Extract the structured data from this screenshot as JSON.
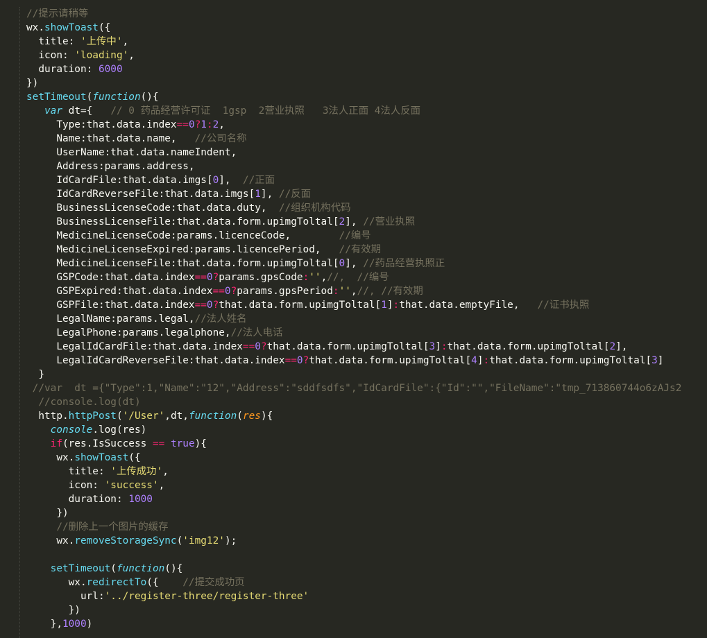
{
  "editor": {
    "theme": "Monokai",
    "colors": {
      "background": "#272822",
      "text": "#f8f8f2",
      "comment": "#75715e",
      "string": "#e6db74",
      "number": "#ae81ff",
      "function": "#66d9ef",
      "keyword": "#f92672",
      "parameter": "#fd971f"
    },
    "lines": [
      [
        [
          "c",
          "//提示请稍等"
        ]
      ],
      [
        [
          "",
          "wx."
        ],
        [
          "f",
          "showToast"
        ],
        [
          "",
          "({"
        ]
      ],
      [
        [
          "",
          "  title: "
        ],
        [
          "s",
          "'上传中'"
        ],
        [
          "",
          ","
        ]
      ],
      [
        [
          "",
          "  icon: "
        ],
        [
          "s",
          "'loading'"
        ],
        [
          "",
          ","
        ]
      ],
      [
        [
          "",
          "  duration: "
        ],
        [
          "n",
          "6000"
        ]
      ],
      [
        [
          "",
          "})"
        ]
      ],
      [
        [
          "f",
          "setTimeout"
        ],
        [
          "",
          "("
        ],
        [
          "i",
          "function"
        ],
        [
          "",
          "(){"
        ]
      ],
      [
        [
          "",
          "   "
        ],
        [
          "i",
          "var"
        ],
        [
          "",
          "",
          " dt={   "
        ],
        [
          "c",
          "// 0 药品经营许可证  1gsp  2营业执照   3法人正面 4法人反面"
        ]
      ],
      [
        [
          "",
          "     Type:that.data.index"
        ],
        [
          "k",
          "=="
        ],
        [
          "n",
          "0"
        ],
        [
          "k",
          "?"
        ],
        [
          "n",
          "1"
        ],
        [
          "k",
          ":"
        ],
        [
          "n",
          "2"
        ],
        [
          "",
          ","
        ]
      ],
      [
        [
          "",
          "     Name:that.data.name,   "
        ],
        [
          "c",
          "//公司名称"
        ]
      ],
      [
        [
          "",
          "     UserName:that.data.nameIndent,"
        ]
      ],
      [
        [
          "",
          "     Address:params.address,"
        ]
      ],
      [
        [
          "",
          "     IdCardFile:that.data.imgs["
        ],
        [
          "n",
          "0"
        ],
        [
          "",
          "],  "
        ],
        [
          "c",
          "//正面"
        ]
      ],
      [
        [
          "",
          "     IdCardReverseFile:that.data.imgs["
        ],
        [
          "n",
          "1"
        ],
        [
          "",
          "], "
        ],
        [
          "c",
          "//反面"
        ]
      ],
      [
        [
          "",
          "     BusinessLicenseCode:that.data.duty,  "
        ],
        [
          "c",
          "//组织机构代码"
        ]
      ],
      [
        [
          "",
          "     BusinessLicenseFile:that.data.form.upimgToltal["
        ],
        [
          "n",
          "2"
        ],
        [
          "",
          "], "
        ],
        [
          "c",
          "//营业执照"
        ]
      ],
      [
        [
          "",
          "     MedicineLicenseCode:params.licenceCode,        "
        ],
        [
          "c",
          "//编号"
        ]
      ],
      [
        [
          "",
          "     MedicineLicenseExpired:params.licencePeriod,   "
        ],
        [
          "c",
          "//有效期"
        ]
      ],
      [
        [
          "",
          "     MedicineLicenseFile:that.data.form.upimgToltal["
        ],
        [
          "n",
          "0"
        ],
        [
          "",
          "], "
        ],
        [
          "c",
          "//药品经营执照正"
        ]
      ],
      [
        [
          "",
          "     GSPCode:that.data.index"
        ],
        [
          "k",
          "=="
        ],
        [
          "n",
          "0"
        ],
        [
          "k",
          "?"
        ],
        [
          "",
          "params.gpsCode"
        ],
        [
          "k",
          ":"
        ],
        [
          "s",
          "''"
        ],
        [
          "",
          ","
        ],
        [
          "c",
          "//,  //编号"
        ]
      ],
      [
        [
          "",
          "     GSPExpired:that.data.index"
        ],
        [
          "k",
          "=="
        ],
        [
          "n",
          "0"
        ],
        [
          "k",
          "?"
        ],
        [
          "",
          "params.gpsPeriod"
        ],
        [
          "k",
          ":"
        ],
        [
          "s",
          "''"
        ],
        [
          "",
          ","
        ],
        [
          "c",
          "//, //有效期"
        ]
      ],
      [
        [
          "",
          "     GSPFile:that.data.index"
        ],
        [
          "k",
          "=="
        ],
        [
          "n",
          "0"
        ],
        [
          "k",
          "?"
        ],
        [
          "",
          "that.data.form.upimgToltal["
        ],
        [
          "n",
          "1"
        ],
        [
          "",
          "]"
        ],
        [
          "k",
          ":"
        ],
        [
          "",
          "that.data.emptyFile,   "
        ],
        [
          "c",
          "//证书执照"
        ]
      ],
      [
        [
          "",
          "     LegalName:params.legal,"
        ],
        [
          "c",
          "//法人姓名"
        ]
      ],
      [
        [
          "",
          "     LegalPhone:params.legalphone,"
        ],
        [
          "c",
          "//法人电话"
        ]
      ],
      [
        [
          "",
          "     LegalIdCardFile:that.data.index"
        ],
        [
          "k",
          "=="
        ],
        [
          "n",
          "0"
        ],
        [
          "k",
          "?"
        ],
        [
          "",
          "that.data.form.upimgToltal["
        ],
        [
          "n",
          "3"
        ],
        [
          "",
          "]"
        ],
        [
          "k",
          ":"
        ],
        [
          "",
          "that.data.form.upimgToltal["
        ],
        [
          "n",
          "2"
        ],
        [
          "",
          "],"
        ]
      ],
      [
        [
          "",
          "     LegalIdCardReverseFile:that.data.index"
        ],
        [
          "k",
          "=="
        ],
        [
          "n",
          "0"
        ],
        [
          "k",
          "?"
        ],
        [
          "",
          "that.data.form.upimgToltal["
        ],
        [
          "n",
          "4"
        ],
        [
          "",
          "]"
        ],
        [
          "k",
          ":"
        ],
        [
          "",
          "that.data.form.upimgToltal["
        ],
        [
          "n",
          "3"
        ],
        [
          "",
          "]"
        ]
      ],
      [
        [
          "",
          "  }"
        ]
      ],
      [
        [
          "c",
          " //var  dt ={\"Type\":1,\"Name\":\"12\",\"Address\":\"sddfsdfs\",\"IdCardFile\":{\"Id\":\"\",\"FileName\":\"tmp_713860744o6zAJs2"
        ]
      ],
      [
        [
          "c",
          "  //console.log(dt)"
        ]
      ],
      [
        [
          "",
          "  http."
        ],
        [
          "f",
          "httpPost"
        ],
        [
          "",
          "("
        ],
        [
          "s",
          "'/User'"
        ],
        [
          "",
          ",dt,"
        ],
        [
          "i",
          "function"
        ],
        [
          "",
          "("
        ],
        [
          "p",
          "res"
        ],
        [
          "",
          "){"
        ]
      ],
      [
        [
          "",
          "    "
        ],
        [
          "i",
          "console"
        ],
        [
          "",
          ".log(res)"
        ]
      ],
      [
        [
          "",
          "    "
        ],
        [
          "k",
          "if"
        ],
        [
          "",
          "(res.IsSuccess "
        ],
        [
          "k",
          "=="
        ],
        [
          "",
          "",
          " "
        ],
        [
          "n",
          "true"
        ],
        [
          "",
          "){"
        ]
      ],
      [
        [
          "",
          "     wx."
        ],
        [
          "f",
          "showToast"
        ],
        [
          "",
          "({"
        ]
      ],
      [
        [
          "",
          "       title: "
        ],
        [
          "s",
          "'上传成功'"
        ],
        [
          "",
          ","
        ]
      ],
      [
        [
          "",
          "       icon: "
        ],
        [
          "s",
          "'success'"
        ],
        [
          "",
          ","
        ]
      ],
      [
        [
          "",
          "       duration: "
        ],
        [
          "n",
          "1000"
        ]
      ],
      [
        [
          "",
          "     })"
        ]
      ],
      [
        [
          "c",
          "     //删除上一个图片的缓存"
        ]
      ],
      [
        [
          "",
          "     wx."
        ],
        [
          "f",
          "removeStorageSync"
        ],
        [
          "",
          "("
        ],
        [
          "s",
          "'img12'"
        ],
        [
          "",
          ");"
        ]
      ],
      [
        [
          "",
          ""
        ]
      ],
      [
        [
          "",
          "    "
        ],
        [
          "f",
          "setTimeout"
        ],
        [
          "",
          "("
        ],
        [
          "i",
          "function"
        ],
        [
          "",
          "(){"
        ]
      ],
      [
        [
          "",
          "       wx."
        ],
        [
          "f",
          "redirectTo"
        ],
        [
          "",
          "({    "
        ],
        [
          "c",
          "//提交成功页"
        ]
      ],
      [
        [
          "",
          "         url:"
        ],
        [
          "s",
          "'../register-three/register-three'"
        ]
      ],
      [
        [
          "",
          "       })"
        ]
      ],
      [
        [
          "",
          "    },"
        ],
        [
          "n",
          "1000"
        ],
        [
          "",
          ")"
        ]
      ]
    ]
  }
}
